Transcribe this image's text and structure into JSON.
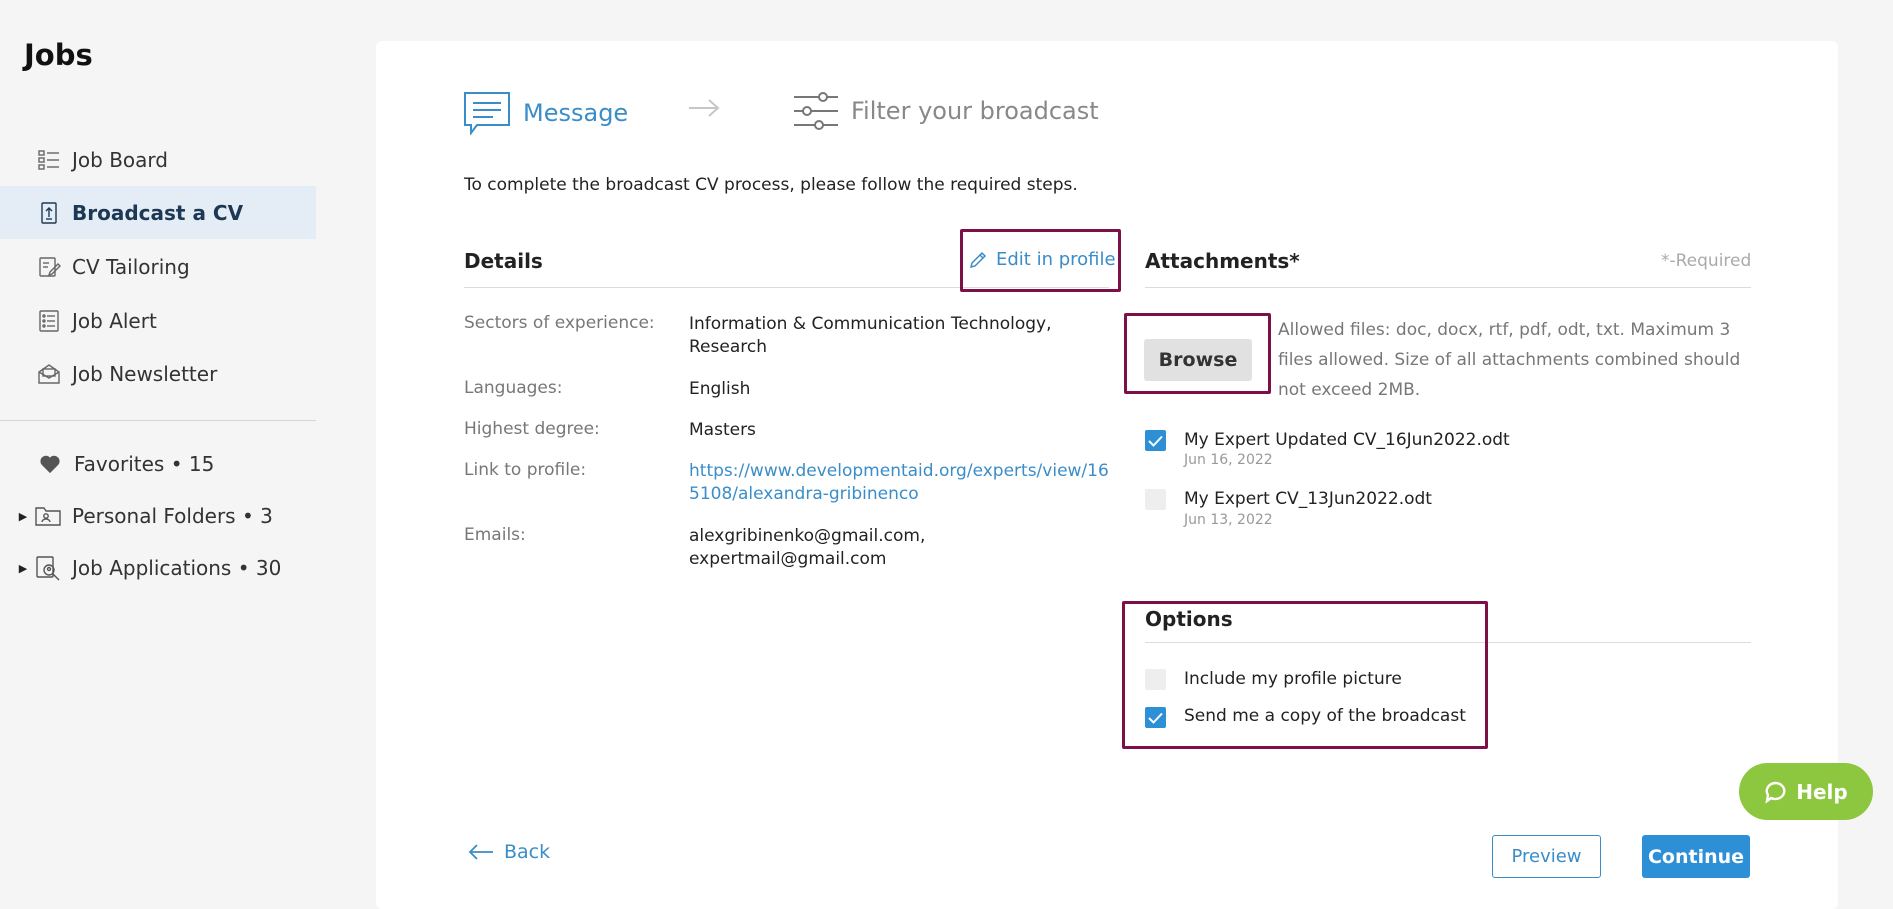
{
  "sidebar": {
    "title": "Jobs",
    "items": [
      {
        "label": "Job Board",
        "icon": "job-board-icon"
      },
      {
        "label": "Broadcast a CV",
        "icon": "broadcast-icon"
      },
      {
        "label": "CV Tailoring",
        "icon": "cv-tailoring-icon"
      },
      {
        "label": "Job Alert",
        "icon": "job-alert-icon"
      },
      {
        "label": "Job Newsletter",
        "icon": "newsletter-icon"
      }
    ],
    "active_item": "Broadcast a CV",
    "extras": [
      {
        "label": "Favorites • 15",
        "icon": "heart-icon"
      },
      {
        "label": "Personal Folders • 3",
        "icon": "folder-icon"
      },
      {
        "label": "Job Applications • 30",
        "icon": "applications-icon"
      }
    ]
  },
  "steps": {
    "message": "Message",
    "filter": "Filter your broadcast"
  },
  "intro": "To complete the broadcast CV process, please follow the required steps.",
  "details": {
    "title": "Details",
    "edit_label": "Edit in profile",
    "rows": [
      {
        "label": "Sectors of experience:",
        "value": "Information & Communication Technology, Research"
      },
      {
        "label": "Languages:",
        "value": "English"
      },
      {
        "label": "Highest degree:",
        "value": "Masters"
      },
      {
        "label": "Link to profile:",
        "value": "https://www.developmentaid.org/experts/view/165108/alexandra-gribinenco"
      },
      {
        "label": "Emails:",
        "value": "alexgribinenko@gmail.com, expertmail@gmail.com"
      }
    ]
  },
  "attachments": {
    "title": "Attachments*",
    "required_note": "*-Required",
    "browse_label": "Browse",
    "allowed_text": "Allowed files: doc, docx, rtf, pdf, odt, txt. Maximum 3 files allowed. Size of all attachments combined should not exceed 2MB.",
    "files": [
      {
        "name": "My Expert Updated CV_16Jun2022.odt",
        "date": "Jun 16, 2022",
        "checked": true
      },
      {
        "name": "My Expert CV_13Jun2022.odt",
        "date": "Jun 13, 2022",
        "checked": false
      }
    ]
  },
  "options": {
    "title": "Options",
    "items": [
      {
        "label": "Include my profile picture",
        "checked": false
      },
      {
        "label": "Send me a copy of the broadcast",
        "checked": true
      }
    ]
  },
  "footer": {
    "back_label": "Back",
    "preview_label": "Preview",
    "continue_label": "Continue"
  },
  "help": {
    "label": "Help"
  },
  "colors": {
    "accent": "#3a8dc8",
    "checkbox": "#2d8fd6",
    "highlight": "#7d1046",
    "help": "#8dc63f",
    "active_bg": "#e4edf5"
  }
}
